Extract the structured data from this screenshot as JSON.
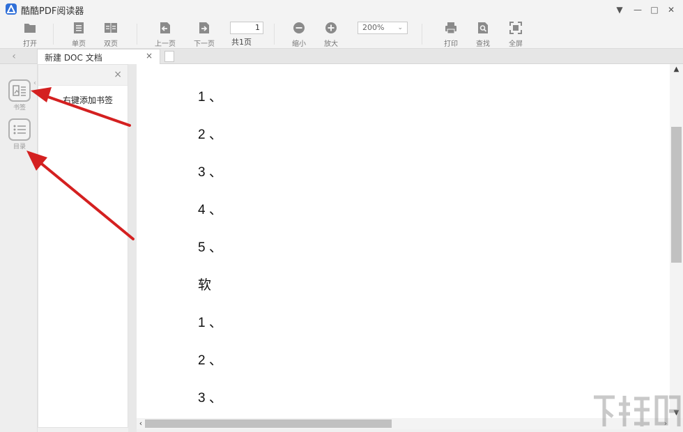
{
  "window": {
    "title": "酷酷PDF阅读器",
    "controls": {
      "dropdown": "▼",
      "minimize": "—",
      "maximize": "□",
      "close": "✕"
    }
  },
  "toolbar": {
    "open_label": "打开",
    "single_page_label": "单页",
    "double_page_label": "双页",
    "prev_page_label": "上一页",
    "next_page_label": "下一页",
    "current_page": "1",
    "total_pages_label": "共1页",
    "zoom_out_label": "缩小",
    "zoom_in_label": "放大",
    "zoom_value": "200%",
    "print_label": "打印",
    "find_label": "查找",
    "fullscreen_label": "全屏"
  },
  "tabs": {
    "back_glyph": "‹",
    "items": [
      {
        "label": "新建 DOC 文档",
        "close_glyph": "×"
      }
    ]
  },
  "sidebar": {
    "bookmark_label": "书签",
    "toc_label": "目录",
    "collapse_glyph": "‹"
  },
  "bookmark_panel": {
    "close_glyph": "×",
    "hint": "右键添加书签"
  },
  "document": {
    "lines": [
      "1 、",
      "2 、",
      "3 、",
      "4 、",
      "5 、",
      "软",
      "1 、",
      "2 、",
      "3 、"
    ]
  },
  "scrollbars": {
    "up": "▲",
    "down": "▼",
    "left": "‹",
    "right": "›"
  },
  "watermark": {
    "text": "下载吧"
  },
  "colors": {
    "accent": "#2f6fd8",
    "annotation_arrow": "#d42020",
    "icon_gray": "#8a8a8a"
  }
}
